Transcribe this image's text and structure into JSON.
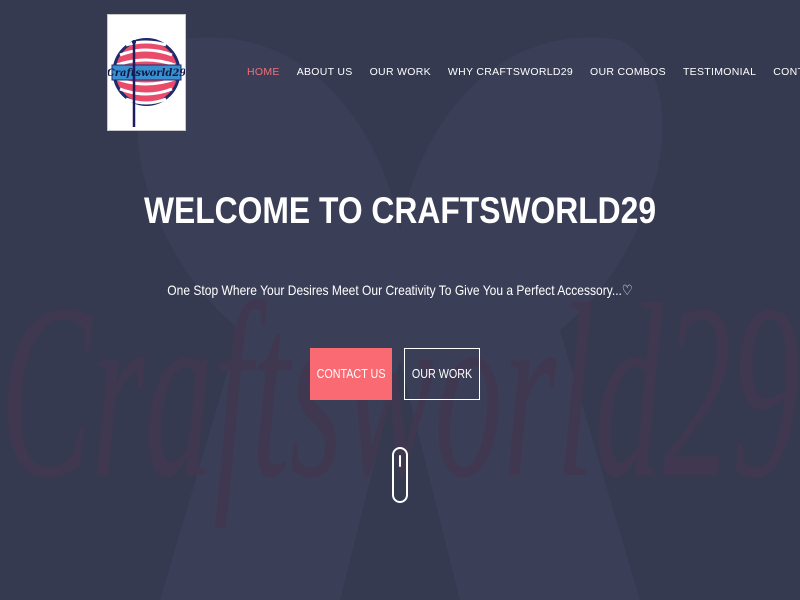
{
  "logo": {
    "text": "Craftsworld29",
    "colors": {
      "ring": "#e94b6a",
      "banner": "#3a8fd0",
      "needle": "#1d1d5e"
    }
  },
  "nav": {
    "items": [
      {
        "label": "HOME",
        "active": true
      },
      {
        "label": "ABOUT US",
        "active": false
      },
      {
        "label": "OUR WORK",
        "active": false
      },
      {
        "label": "WHY CRAFTSWORLD29",
        "active": false
      },
      {
        "label": "OUR COMBOS",
        "active": false
      },
      {
        "label": "TESTIMONIAL",
        "active": false
      },
      {
        "label": "CONTACT US",
        "active": false
      }
    ]
  },
  "hero": {
    "title": "WELCOME TO CRAFTSWORLD29",
    "subtitle": "One Stop Where Your Desires Meet Our Creativity To Give You a Perfect Accessory...♡",
    "watermark": "Craftsworld29",
    "primary_button": "CONTACT US",
    "secondary_button": "OUR WORK"
  },
  "icons": {
    "scroll": "mouse-scroll-icon"
  },
  "colors": {
    "background": "#353a51",
    "accent": "#fa6a73",
    "active_nav": "#f1707b",
    "text": "#ffffff"
  }
}
